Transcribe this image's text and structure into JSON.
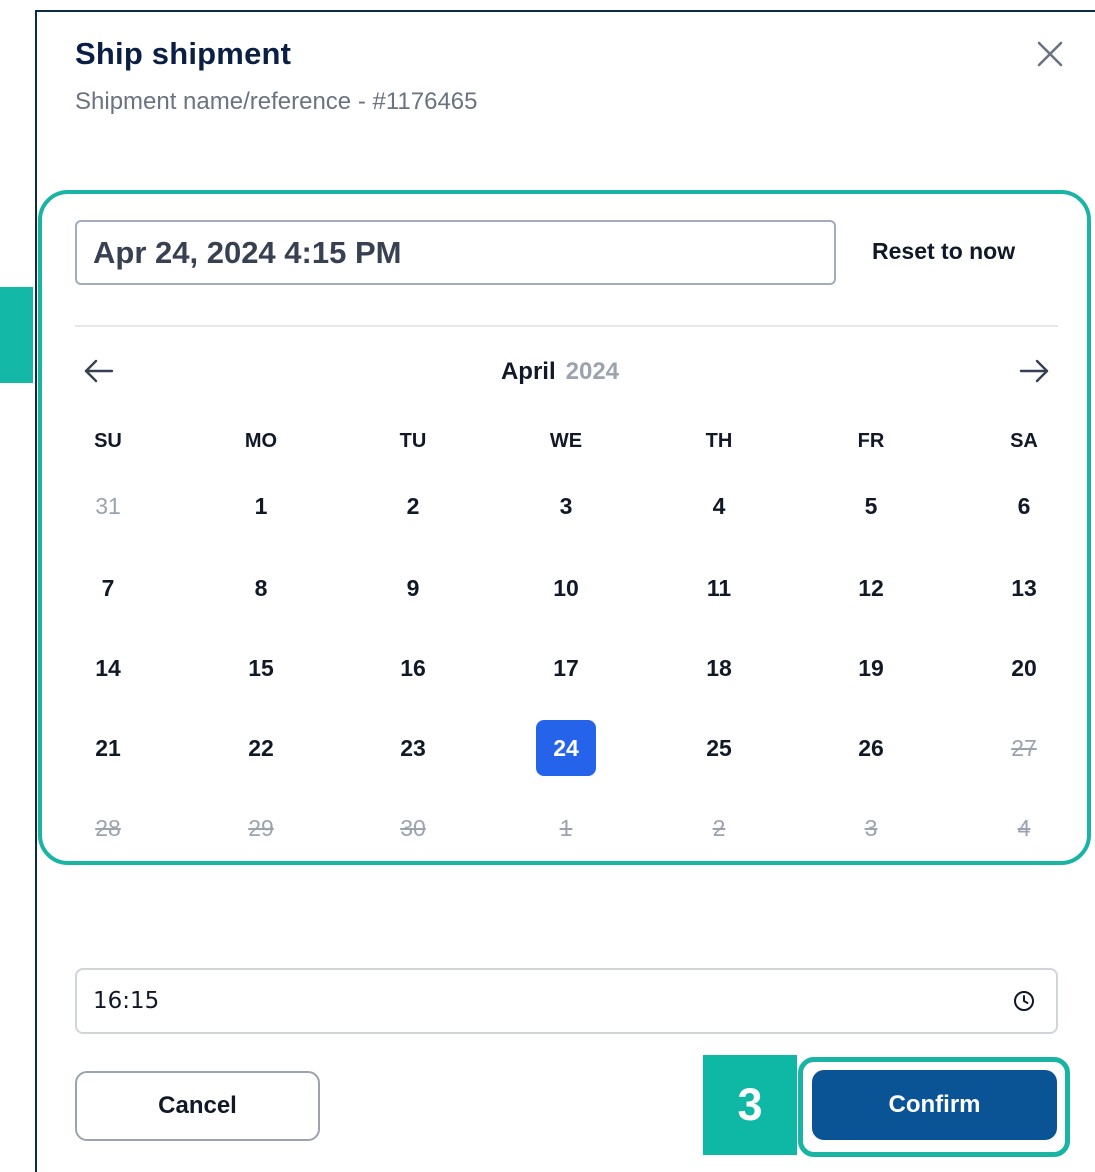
{
  "dialog": {
    "title": "Ship shipment",
    "subtitle": "Shipment name/reference - #1176465"
  },
  "datetime": {
    "value": "Apr 24, 2024 4:15 PM",
    "reset_label": "Reset to now"
  },
  "calendar": {
    "month": "April",
    "year": "2024",
    "weekdays": [
      "SU",
      "MO",
      "TU",
      "WE",
      "TH",
      "FR",
      "SA"
    ],
    "weeks": [
      [
        {
          "d": "31",
          "s": "muted"
        },
        {
          "d": "1",
          "s": "normal"
        },
        {
          "d": "2",
          "s": "normal"
        },
        {
          "d": "3",
          "s": "normal"
        },
        {
          "d": "4",
          "s": "normal"
        },
        {
          "d": "5",
          "s": "normal"
        },
        {
          "d": "6",
          "s": "normal"
        }
      ],
      [
        {
          "d": "7",
          "s": "normal"
        },
        {
          "d": "8",
          "s": "normal"
        },
        {
          "d": "9",
          "s": "normal"
        },
        {
          "d": "10",
          "s": "normal"
        },
        {
          "d": "11",
          "s": "normal"
        },
        {
          "d": "12",
          "s": "normal"
        },
        {
          "d": "13",
          "s": "normal"
        }
      ],
      [
        {
          "d": "14",
          "s": "normal"
        },
        {
          "d": "15",
          "s": "normal"
        },
        {
          "d": "16",
          "s": "normal"
        },
        {
          "d": "17",
          "s": "normal"
        },
        {
          "d": "18",
          "s": "normal"
        },
        {
          "d": "19",
          "s": "normal"
        },
        {
          "d": "20",
          "s": "normal"
        }
      ],
      [
        {
          "d": "21",
          "s": "normal"
        },
        {
          "d": "22",
          "s": "normal"
        },
        {
          "d": "23",
          "s": "normal"
        },
        {
          "d": "24",
          "s": "selected"
        },
        {
          "d": "25",
          "s": "normal"
        },
        {
          "d": "26",
          "s": "normal"
        },
        {
          "d": "27",
          "s": "disabled"
        }
      ],
      [
        {
          "d": "28",
          "s": "disabled"
        },
        {
          "d": "29",
          "s": "disabled"
        },
        {
          "d": "30",
          "s": "disabled"
        },
        {
          "d": "1",
          "s": "disabled"
        },
        {
          "d": "2",
          "s": "disabled"
        },
        {
          "d": "3",
          "s": "disabled"
        },
        {
          "d": "4",
          "s": "disabled"
        }
      ]
    ]
  },
  "time": {
    "value": "16:15"
  },
  "actions": {
    "cancel_label": "Cancel",
    "confirm_label": "Confirm"
  },
  "step_badge": "3",
  "colors": {
    "accent_teal": "#19b4a4",
    "primary_blue": "#0a5496",
    "selected_day": "#2563eb"
  },
  "icons": {
    "close": "close-icon",
    "prev": "arrow-left-icon",
    "next": "arrow-right-icon",
    "clock": "clock-icon"
  }
}
